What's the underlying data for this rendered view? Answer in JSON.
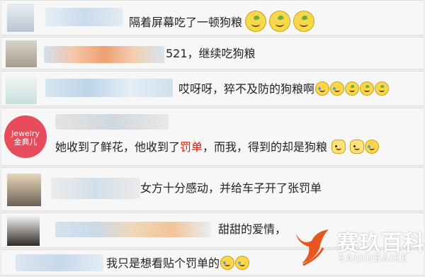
{
  "comments": [
    {
      "text": "隔着屏幕吃了一顿狗粮"
    },
    {
      "text": "521，继续吃狗粮"
    },
    {
      "text": "哎呀呀，猝不及防的狗粮啊"
    },
    {
      "text_part1": "她收到了鲜花，他收到了",
      "text_highlight": "罚单",
      "text_part2": "，而我，得到的却是狗粮"
    },
    {
      "text": "女方十分感动，并给车子开了张罚单"
    },
    {
      "text": "甜甜的爱情，"
    },
    {
      "text": "我只是想看贴个罚单的"
    }
  ],
  "watermark": {
    "title": "赛玖百科",
    "subtitle": "SAIJIUBAIKE"
  },
  "avatar_badge": "Jewelry\n金典儿",
  "colors": {
    "highlight": "#d81e06",
    "watermark_orange": "#e8561f"
  },
  "icons": [
    "orange-smile-emoji",
    "laugh-cry-emoji",
    "cat-face-emoji"
  ]
}
